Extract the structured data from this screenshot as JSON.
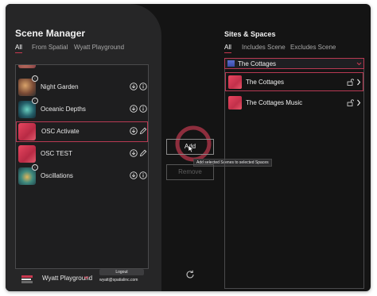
{
  "window": {
    "traffic_lights": {
      "close": "#fe5f57",
      "minimize": "#febc2e",
      "zoom": "#28c840"
    }
  },
  "scene_manager": {
    "title": "Scene Manager",
    "tabs": [
      {
        "label": "All",
        "active": true
      },
      {
        "label": "From Spatial",
        "active": false
      },
      {
        "label": "Wyatt Playground",
        "active": false
      }
    ],
    "scenes": [
      {
        "name": "Night Garden",
        "action": "download",
        "selected": false
      },
      {
        "name": "Oceanic Depths",
        "action": "download",
        "selected": false
      },
      {
        "name": "OSC Activate",
        "action": "edit",
        "selected": true
      },
      {
        "name": "OSC TEST",
        "action": "edit",
        "selected": false
      },
      {
        "name": "Oscillations",
        "action": "download",
        "selected": false
      }
    ]
  },
  "footer": {
    "workspace": "Wyatt Playground",
    "logout_label": "Logout",
    "email": "wyatt@spatialinc.com"
  },
  "actions": {
    "add_label": "Add",
    "remove_label": "Remove",
    "tooltip": "Add selected Scenes to selected Spaces"
  },
  "sites_spaces": {
    "title": "Sites & Spaces",
    "tabs": [
      {
        "label": "All",
        "active": true
      },
      {
        "label": "Includes Scene",
        "active": false
      },
      {
        "label": "Excludes Scene",
        "active": false
      }
    ],
    "site_select": "The Cottages",
    "spaces": [
      {
        "name": "The Cottages",
        "selected": true
      },
      {
        "name": "The Cottages Music",
        "selected": false
      }
    ]
  },
  "colors": {
    "accent": "#c8384f",
    "background": "#141414",
    "panel": "#262627"
  }
}
